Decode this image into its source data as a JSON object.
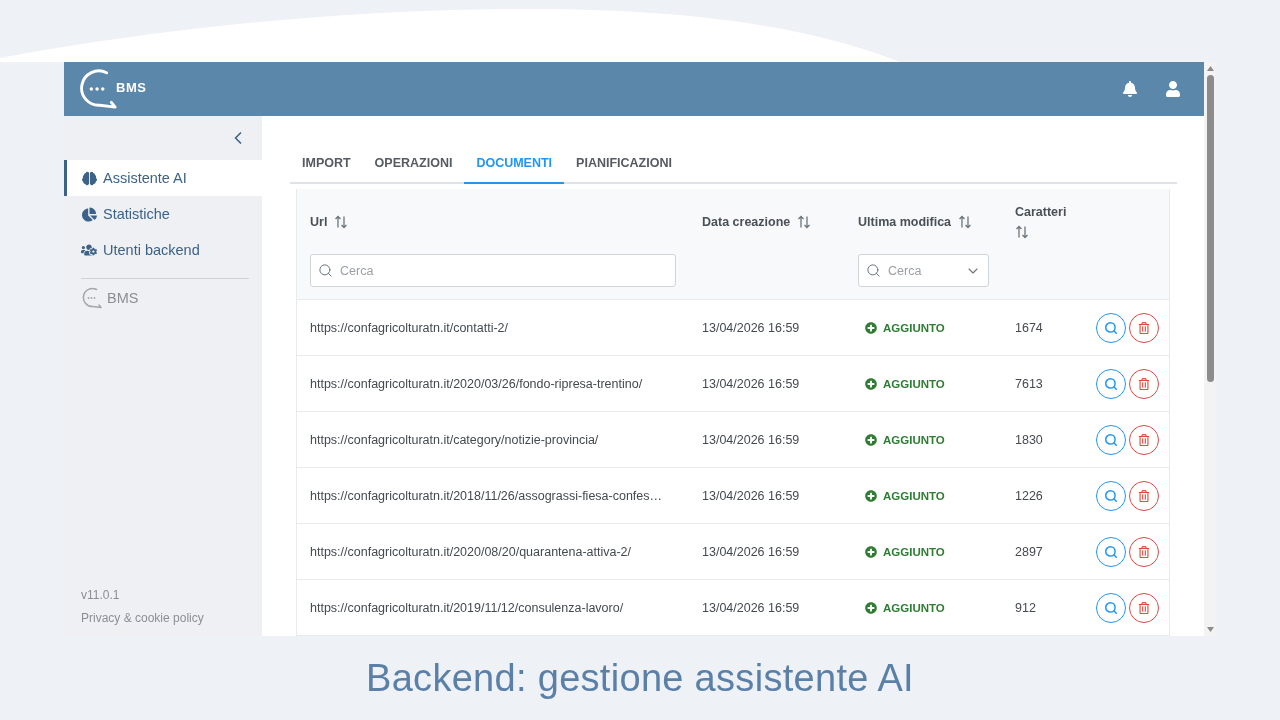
{
  "header": {
    "logo_text": "BMS"
  },
  "sidebar": {
    "items": [
      {
        "label": "Assistente AI",
        "kind": "assistant",
        "selected": true
      },
      {
        "label": "Statistiche",
        "kind": "stats",
        "selected": false
      },
      {
        "label": "Utenti backend",
        "kind": "users",
        "selected": false
      }
    ],
    "app_link": "BMS",
    "version": "v11.0.1",
    "privacy": "Privacy & cookie policy"
  },
  "tabs": [
    {
      "label": "IMPORT",
      "selected": false
    },
    {
      "label": "OPERAZIONI",
      "selected": false
    },
    {
      "label": "DOCUMENTI",
      "selected": true
    },
    {
      "label": "PIANIFICAZIONI",
      "selected": false
    }
  ],
  "table": {
    "columns": [
      {
        "label": "Url",
        "filter": {
          "kind": "text",
          "placeholder": "Cerca"
        }
      },
      {
        "label": "Data creazione"
      },
      {
        "label": "Ultima modifica",
        "filter": {
          "kind": "dropdown",
          "placeholder": "Cerca"
        }
      },
      {
        "label": "Caratteri"
      }
    ],
    "rows": [
      {
        "url": "https://confagricolturatn.it/contatti-2/",
        "created": "13/04/2026 16:59",
        "status": {
          "kind": "added",
          "label": "AGGIUNTO"
        },
        "characters": "1674"
      },
      {
        "url": "https://confagricolturatn.it/2020/03/26/fondo-ripresa-trentino/",
        "created": "13/04/2026 16:59",
        "status": {
          "kind": "added",
          "label": "AGGIUNTO"
        },
        "characters": "7613"
      },
      {
        "url": "https://confagricolturatn.it/category/notizie-provincia/",
        "created": "13/04/2026 16:59",
        "status": {
          "kind": "added",
          "label": "AGGIUNTO"
        },
        "characters": "1830"
      },
      {
        "url": "https://confagricolturatn.it/2018/11/26/assograssi-fiesa-confes…",
        "created": "13/04/2026 16:59",
        "status": {
          "kind": "added",
          "label": "AGGIUNTO"
        },
        "characters": "1226"
      },
      {
        "url": "https://confagricolturatn.it/2020/08/20/quarantena-attiva-2/",
        "created": "13/04/2026 16:59",
        "status": {
          "kind": "added",
          "label": "AGGIUNTO"
        },
        "characters": "2897"
      },
      {
        "url": "https://confagricolturatn.it/2019/11/12/consulenza-lavoro/",
        "created": "13/04/2026 16:59",
        "status": {
          "kind": "added",
          "label": "AGGIUNTO"
        },
        "characters": "912"
      }
    ]
  },
  "caption": "Backend: gestione assistente AI"
}
